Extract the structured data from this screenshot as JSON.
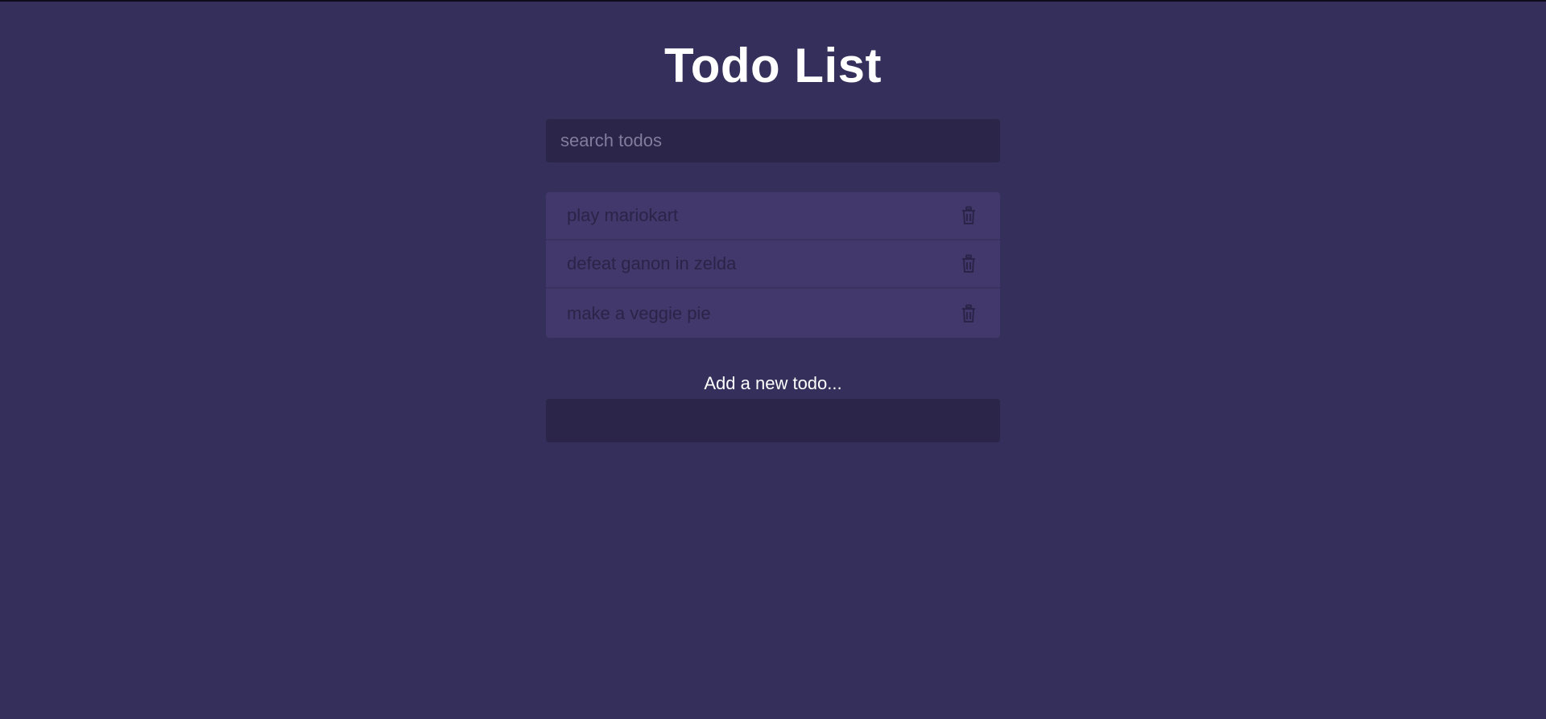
{
  "page": {
    "title": "Todo List"
  },
  "search": {
    "placeholder": "search todos",
    "value": ""
  },
  "todos": [
    {
      "text": "play mariokart",
      "icon": "trash-icon"
    },
    {
      "text": "defeat ganon in zelda",
      "icon": "trash-icon"
    },
    {
      "text": "make a veggie pie",
      "icon": "trash-icon"
    }
  ],
  "add": {
    "label": "Add a new todo...",
    "value": ""
  },
  "colors": {
    "background": "#352f5b",
    "input_background": "#2a2549",
    "item_background": "#42386b",
    "item_text": "#2a2548",
    "heading": "#ffffff"
  }
}
